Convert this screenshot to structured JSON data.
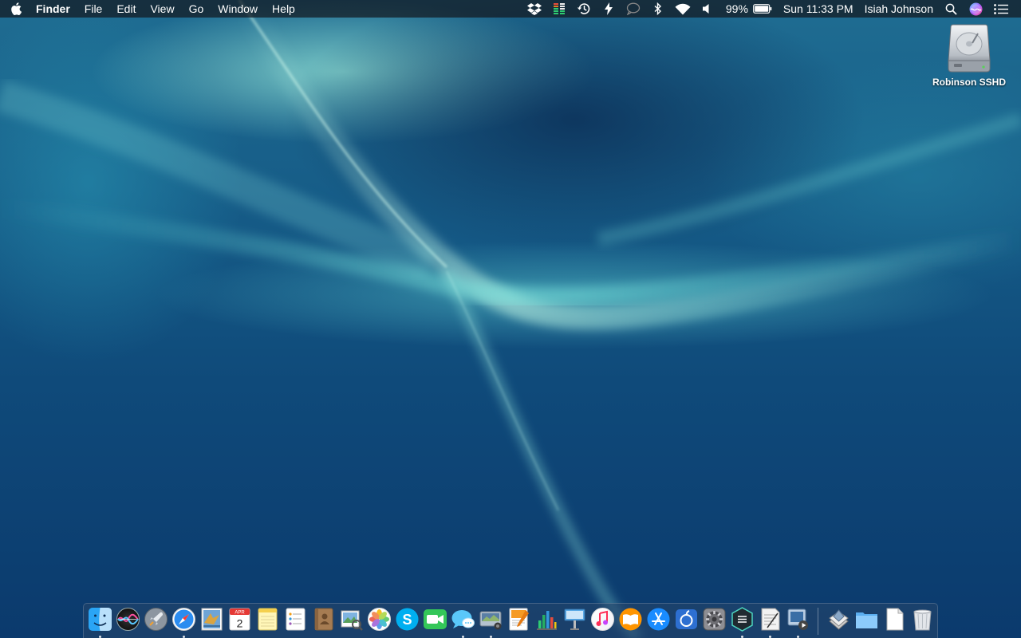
{
  "menubar": {
    "app_name": "Finder",
    "menus": [
      "File",
      "Edit",
      "View",
      "Go",
      "Window",
      "Help"
    ],
    "battery_percent": "99%",
    "clock": "Sun 11:33 PM",
    "user": "Isiah Johnson",
    "status_icons": [
      "dropbox-icon",
      "istat-menus-icon",
      "time-machine-icon",
      "flux-icon",
      "messages-status-icon",
      "bluetooth-icon",
      "wifi-icon",
      "volume-icon",
      "battery-icon",
      "spotlight-icon",
      "siri-icon",
      "notification-center-icon"
    ]
  },
  "desktop": {
    "volume_label": "Robinson SSHD"
  },
  "dock": {
    "apps": [
      {
        "name": "finder",
        "running": true
      },
      {
        "name": "siri",
        "running": false
      },
      {
        "name": "launchpad",
        "running": false
      },
      {
        "name": "safari",
        "running": true
      },
      {
        "name": "mail",
        "running": false
      },
      {
        "name": "calendar",
        "running": false,
        "date": "2",
        "month": "APR"
      },
      {
        "name": "notes",
        "running": false
      },
      {
        "name": "reminders",
        "running": false
      },
      {
        "name": "contacts",
        "running": false
      },
      {
        "name": "preview",
        "running": false
      },
      {
        "name": "photos",
        "running": false
      },
      {
        "name": "skype",
        "running": false
      },
      {
        "name": "facetime",
        "running": false
      },
      {
        "name": "messages",
        "running": true
      },
      {
        "name": "image-capture",
        "running": true
      },
      {
        "name": "pages",
        "running": false
      },
      {
        "name": "numbers",
        "running": false
      },
      {
        "name": "keynote",
        "running": false
      },
      {
        "name": "itunes",
        "running": false
      },
      {
        "name": "ibooks",
        "running": false
      },
      {
        "name": "app-store",
        "running": false
      },
      {
        "name": "toolbox",
        "running": false
      },
      {
        "name": "system-preferences",
        "running": false
      },
      {
        "name": "hex-app",
        "running": true
      },
      {
        "name": "script-editor",
        "running": true
      },
      {
        "name": "quicktime",
        "running": true
      }
    ],
    "stacks": [
      {
        "name": "applications-stack"
      },
      {
        "name": "documents-folder"
      },
      {
        "name": "document-stack"
      },
      {
        "name": "trash"
      }
    ]
  }
}
